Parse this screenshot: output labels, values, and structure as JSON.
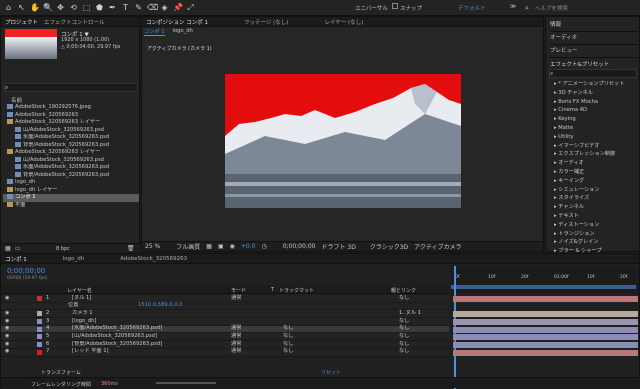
{
  "toolbar": {
    "tools": [
      "⌂",
      "↖",
      "✋",
      "🔍",
      "✥",
      "⟲",
      "⬚",
      "⬟",
      "✒",
      "T",
      "✎",
      "⌫",
      "◈",
      "📌",
      "⤢"
    ],
    "unified": "ユニバーサル",
    "snap": "スナップ",
    "workspace": "デフォルト",
    "menu": "≫",
    "search_placeholder": "ヘルプを検索"
  },
  "project": {
    "tab": "プロジェクト",
    "tab2": "エフェクトコントロール",
    "comp_name": "コンポ 1 ▼",
    "comp_info1": "1920 x 1080 (1.00)",
    "comp_info2": "△ 0;00;04;00, 29.97 fps",
    "search_icon": "⌕",
    "col_name": "名前",
    "items": [
      {
        "label": "AdobeStock_190292576.jpeg",
        "kind": "file",
        "indent": 0
      },
      {
        "label": "AdobeStock_320569263",
        "kind": "file",
        "indent": 0
      },
      {
        "label": "AdobeStock_320569263 レイヤー",
        "kind": "folder",
        "indent": 0
      },
      {
        "label": "山/AdobeStock_320569263.psd",
        "kind": "file",
        "indent": 1
      },
      {
        "label": "氷面/AdobeStock_320569263.psd",
        "kind": "file",
        "indent": 1
      },
      {
        "label": "背景/AdobeStock_320569263.psd",
        "kind": "file",
        "indent": 1
      },
      {
        "label": "AdobeStock_320569263 レイヤー",
        "kind": "folder",
        "indent": 0
      },
      {
        "label": "山/AdobeStock_320569263.psd",
        "kind": "file",
        "indent": 1
      },
      {
        "label": "氷面/AdobeStock_320569263.psd",
        "kind": "file",
        "indent": 1
      },
      {
        "label": "背景/AdobeStock_320569263.psd",
        "kind": "file",
        "indent": 1
      },
      {
        "label": "logo_dh",
        "kind": "file",
        "indent": 0
      },
      {
        "label": "logo_dh レイヤー",
        "kind": "folder",
        "indent": 0
      },
      {
        "label": "コンポ 1",
        "kind": "comp",
        "indent": 0
      },
      {
        "label": "平面",
        "kind": "folder",
        "indent": 0
      }
    ],
    "bottom_info": "8 bpc"
  },
  "viewer": {
    "tab1": "コンポジション コンポ 1",
    "tab2": "フッテージ (なし)",
    "tab3": "レイヤー (なし)",
    "subtab1": "コンポ 1",
    "subtab2": "logo_dh",
    "camera_label": "アクティブカメラ (カメラ 1)",
    "zoom": "25 %",
    "quality": "フル画質",
    "plus": "+0.0",
    "timecode": "0;00;00;00",
    "renderer": "ドラフト 3D",
    "renderer2": "クラシック3D",
    "view": "アクティブカメラ"
  },
  "right": {
    "items": [
      "情報",
      "オーディオ",
      "プレビュー"
    ],
    "fx_title": "エフェクト&プリセット",
    "search_icon": "⌕",
    "fx": [
      "* アニメーションプリセット",
      "3D チャンネル",
      "Boris FX Mocha",
      "Cinema 4D",
      "Keying",
      "Matte",
      "Utility",
      "イマーシブビデオ",
      "エクスプレッション制御",
      "オーディオ",
      "カラー補正",
      "キーイング",
      "シミュレーション",
      "スタイライズ",
      "チャンネル",
      "テキスト",
      "ディストーション",
      "トランジション",
      "ノイズ&グレイン",
      "ブラー & シャープ"
    ]
  },
  "timeline": {
    "tabs": [
      "コンポ 1",
      "logo_dh",
      "AdobeStock_320569263"
    ],
    "timecode": "0;00;00;00",
    "fps": "00000 (29.97 fps)",
    "cols": {
      "source": "レイヤー名",
      "mode": "モード",
      "track": "T",
      "trackmatte": "トラックマット",
      "parent": "親とリンク"
    },
    "ruler": [
      "0f",
      "10f",
      "20f",
      "01:00f",
      "10f",
      "20f"
    ],
    "layers": [
      {
        "num": "1",
        "name": "[ヌル 1]",
        "mode": "通常",
        "tm": "",
        "parent": "なし",
        "color": "#b33",
        "bar": "#b8787c",
        "sel": false
      },
      {
        "num": "",
        "name": "位置",
        "mode": "",
        "tm": "",
        "parent": "",
        "color": "",
        "bar": "",
        "sub": true,
        "val": "1510.0,589.0,0.0"
      },
      {
        "num": "2",
        "name": "カメラ 1",
        "mode": "",
        "tm": "",
        "parent": "1. ヌル 1",
        "color": "#b8a9a0",
        "bar": "#b8a9a0",
        "sel": false
      },
      {
        "num": "3",
        "name": "[logo_dh]",
        "mode": "",
        "tm": "",
        "parent": "なし",
        "color": "#8c8cc8",
        "bar": "#9a94b0",
        "sel": false
      },
      {
        "num": "4",
        "name": "[氷面/AdobeStock_320569263.psd]",
        "mode": "通常",
        "tm": "なし",
        "parent": "なし",
        "color": "#8c8cc8",
        "bar": "#8c8cb4",
        "sel": true
      },
      {
        "num": "5",
        "name": "[山/AdobeStock_320569263.psd]",
        "mode": "通常",
        "tm": "なし",
        "parent": "なし",
        "color": "#8c8cc8",
        "bar": "#8c8cb4",
        "sel": false
      },
      {
        "num": "6",
        "name": "[背景/AdobeStock_320569263.psd]",
        "mode": "通常",
        "tm": "なし",
        "parent": "なし",
        "color": "#8c8cc8",
        "bar": "#8c8cb4",
        "sel": false
      },
      {
        "num": "7",
        "name": "[レッド 平面 1]",
        "mode": "通常",
        "tm": "なし",
        "parent": "なし",
        "color": "#c22",
        "bar": "#b8787c",
        "sel": false
      }
    ],
    "transform_label": "トランスフォーム",
    "reset": "リセット",
    "footer": "フレームレンダリング時間",
    "render_time": "360ms"
  }
}
